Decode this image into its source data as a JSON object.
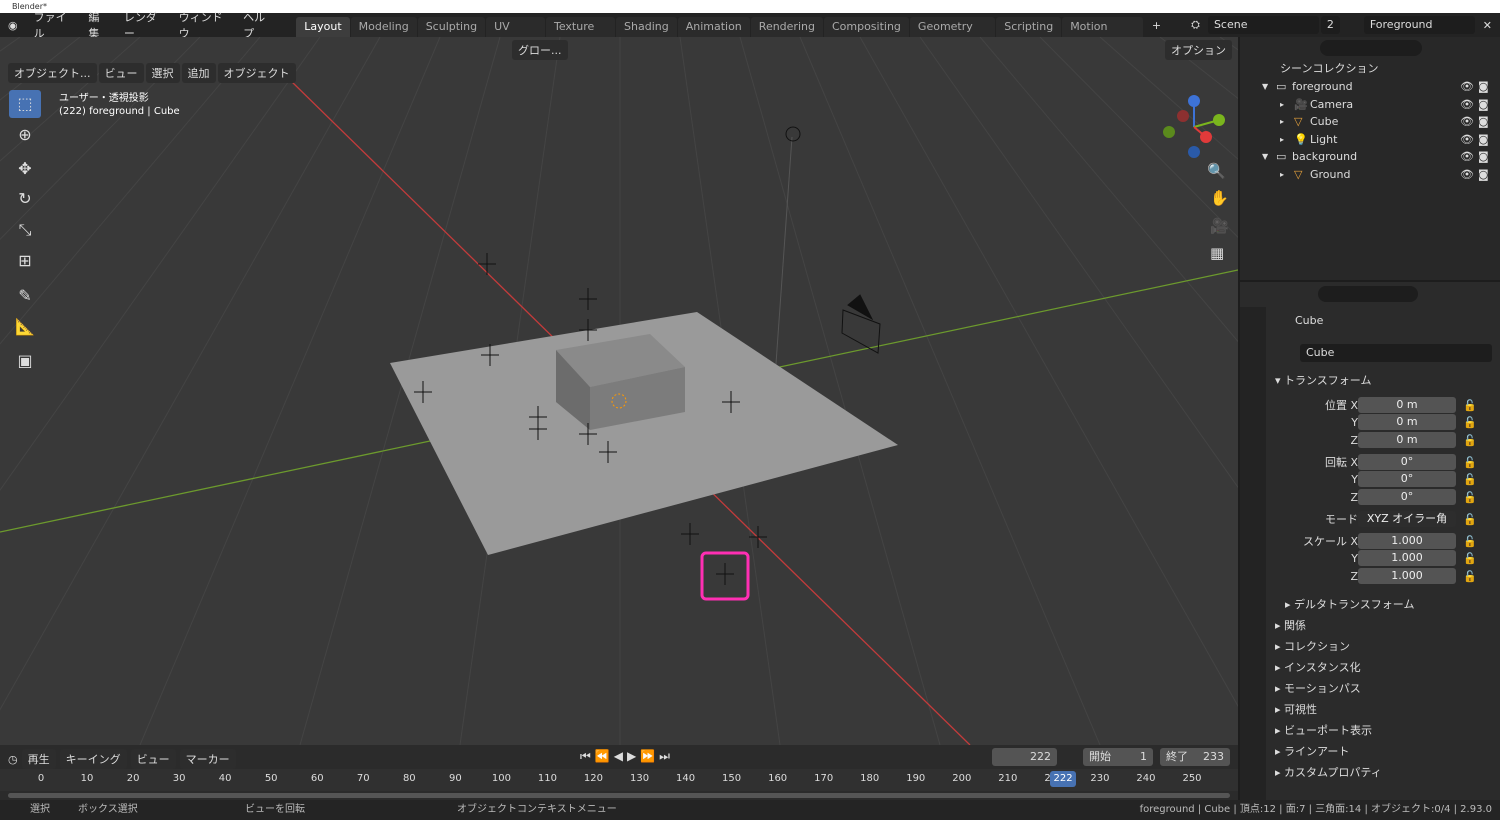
{
  "window": {
    "title": "Blender*"
  },
  "menu": [
    "ファイル",
    "編集",
    "レンダー",
    "ウィンドウ",
    "ヘルプ"
  ],
  "workspaces": [
    "Layout",
    "Modeling",
    "Sculpting",
    "UV Editing",
    "Texture Paint",
    "Shading",
    "Animation",
    "Rendering",
    "Compositing",
    "Geometry Nodes",
    "Scripting",
    "Motion Tracking"
  ],
  "scene": {
    "name": "Scene",
    "users": "2",
    "view_layer": "Foreground"
  },
  "viewport": {
    "header_menu": [
      "オブジェクト...",
      "ビュー",
      "選択",
      "追加",
      "オブジェクト"
    ],
    "transform_orientation": "グロー...",
    "options": "オプション",
    "view_name": "ユーザー・透視投影",
    "view_info": "(222) foreground | Cube",
    "highlight_color": "#ff2fb3",
    "x_axis_color": "#c33b3b",
    "y_axis_color": "#6c9a2d"
  },
  "outliner": {
    "root": "シーンコレクション",
    "rows": [
      {
        "label": "foreground",
        "indent": 1,
        "type": "collection"
      },
      {
        "label": "Camera",
        "indent": 2,
        "type": "camera"
      },
      {
        "label": "Cube",
        "indent": 2,
        "type": "mesh"
      },
      {
        "label": "Light",
        "indent": 2,
        "type": "light"
      },
      {
        "label": "background",
        "indent": 1,
        "type": "collection"
      },
      {
        "label": "Ground",
        "indent": 2,
        "type": "mesh"
      }
    ]
  },
  "properties": {
    "object_name": "Cube",
    "datablock": "Cube",
    "transform_label": "トランスフォーム",
    "rows": [
      {
        "label": "位置 X",
        "value": "0 m"
      },
      {
        "label": "Y",
        "value": "0 m"
      },
      {
        "label": "Z",
        "value": "0 m"
      },
      {
        "label": "回転 X",
        "value": "0°"
      },
      {
        "label": "Y",
        "value": "0°"
      },
      {
        "label": "Z",
        "value": "0°"
      },
      {
        "label": "モード",
        "value": "XYZ オイラー角"
      },
      {
        "label": "スケール X",
        "value": "1.000"
      },
      {
        "label": "Y",
        "value": "1.000"
      },
      {
        "label": "Z",
        "value": "1.000"
      }
    ],
    "delta": "デルタトランスフォーム",
    "sections": [
      "関係",
      "コレクション",
      "インスタンス化",
      "モーションパス",
      "可視性",
      "ビューポート表示",
      "ラインアート",
      "カスタムプロパティ"
    ]
  },
  "timeline": {
    "menu": [
      "再生",
      "キーイング",
      "ビュー",
      "マーカー"
    ],
    "current_frame": "222",
    "start_label": "開始",
    "start": "1",
    "end_label": "終了",
    "end": "233",
    "ticks": [
      "0",
      "10",
      "20",
      "30",
      "40",
      "50",
      "60",
      "70",
      "80",
      "90",
      "100",
      "110",
      "120",
      "130",
      "140",
      "150",
      "160",
      "170",
      "180",
      "190",
      "200",
      "210",
      "220",
      "230",
      "240",
      "250"
    ]
  },
  "status": {
    "left": [
      "選択",
      "ボックス選択",
      "ビューを回転",
      "オブジェクトコンテキストメニュー"
    ],
    "right": "foreground | Cube | 頂点:12 | 面:7 | 三角面:14 | オブジェクト:0/4 | 2.93.0"
  }
}
